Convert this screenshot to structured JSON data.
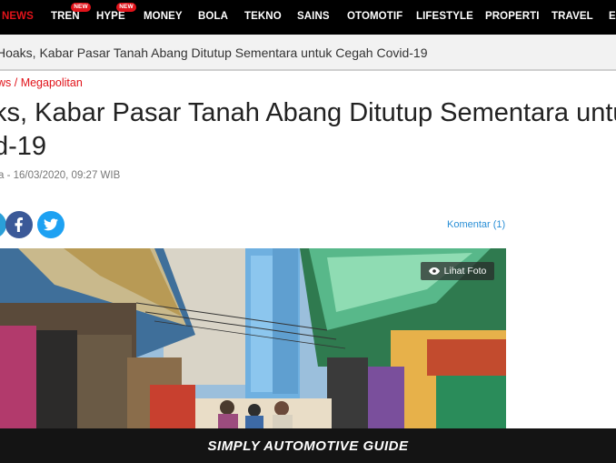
{
  "nav": {
    "items": [
      {
        "label": "NEWS",
        "active": true
      },
      {
        "label": "TREN",
        "badge": "NEW"
      },
      {
        "label": "HYPE",
        "badge": "NEW"
      },
      {
        "label": "MONEY"
      },
      {
        "label": "BOLA"
      },
      {
        "label": "TEKNO"
      },
      {
        "label": "SAINS"
      },
      {
        "label": "OTOMOTIF"
      },
      {
        "label": "LIFESTYLE"
      },
      {
        "label": "PROPERTI"
      },
      {
        "label": "TRAVEL"
      },
      {
        "label": "EDU"
      }
    ]
  },
  "trending": {
    "text": "Hoaks, Kabar Pasar Tanah Abang Ditutup Sementara untuk Cegah Covid-19"
  },
  "breadcrumb": {
    "text": "ws / Megapolitan"
  },
  "article": {
    "headline_line1": "ks, Kabar Pasar Tanah Abang Ditutup Sementara untuk",
    "headline_line2": "d-19",
    "byline": "a - 16/03/2020, 09:27 WIB",
    "comments": "Komentar (1)",
    "photo_button": "Lihat Foto"
  },
  "banner": {
    "text": "SIMPLY AUTOMOTIVE GUIDE"
  },
  "icons": {
    "facebook": "facebook-icon",
    "twitter": "twitter-icon",
    "eye": "eye-icon"
  },
  "colors": {
    "accent": "#e1131a",
    "facebook": "#3b5998",
    "twitter": "#1da1f2",
    "link": "#2a8fd6"
  }
}
